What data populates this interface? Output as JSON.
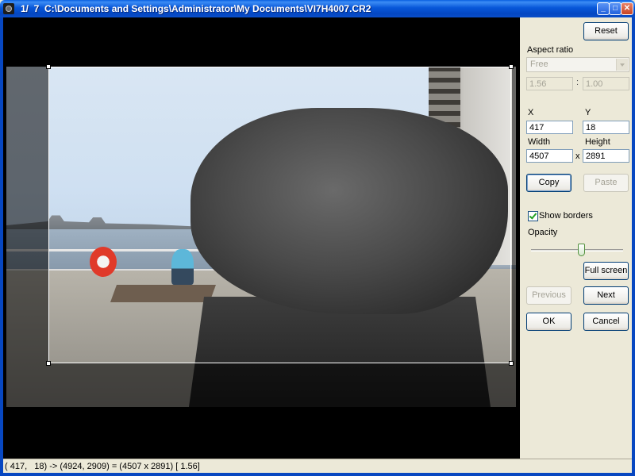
{
  "window": {
    "title": "1/  7  C:\\Documents and Settings\\Administrator\\My Documents\\VI7H4007.CR2",
    "minimize_glyph": "_",
    "maximize_glyph": "□",
    "close_glyph": "✕"
  },
  "panel": {
    "reset_label": "Reset",
    "aspect_ratio_label": "Aspect ratio",
    "aspect_ratio_selected": "Free",
    "ratio_w": "1.56",
    "ratio_sep": ":",
    "ratio_h": "1.00",
    "x_label": "X",
    "y_label": "Y",
    "x_value": "417",
    "y_value": "18",
    "width_label": "Width",
    "height_label": "Height",
    "width_value": "4507",
    "height_value": "2891",
    "times_sep": "x",
    "copy_label": "Copy",
    "paste_label": "Paste",
    "show_borders_label": "Show borders",
    "show_borders_checked": true,
    "opacity_label": "Opacity",
    "opacity_value": 0.55,
    "full_screen_label": "Full screen",
    "previous_label": "Previous",
    "next_label": "Next",
    "ok_label": "OK",
    "cancel_label": "Cancel"
  },
  "status": {
    "text": "( 417,   18) -> (4924, 2909) = (4507 x 2891) [ 1.56]"
  }
}
